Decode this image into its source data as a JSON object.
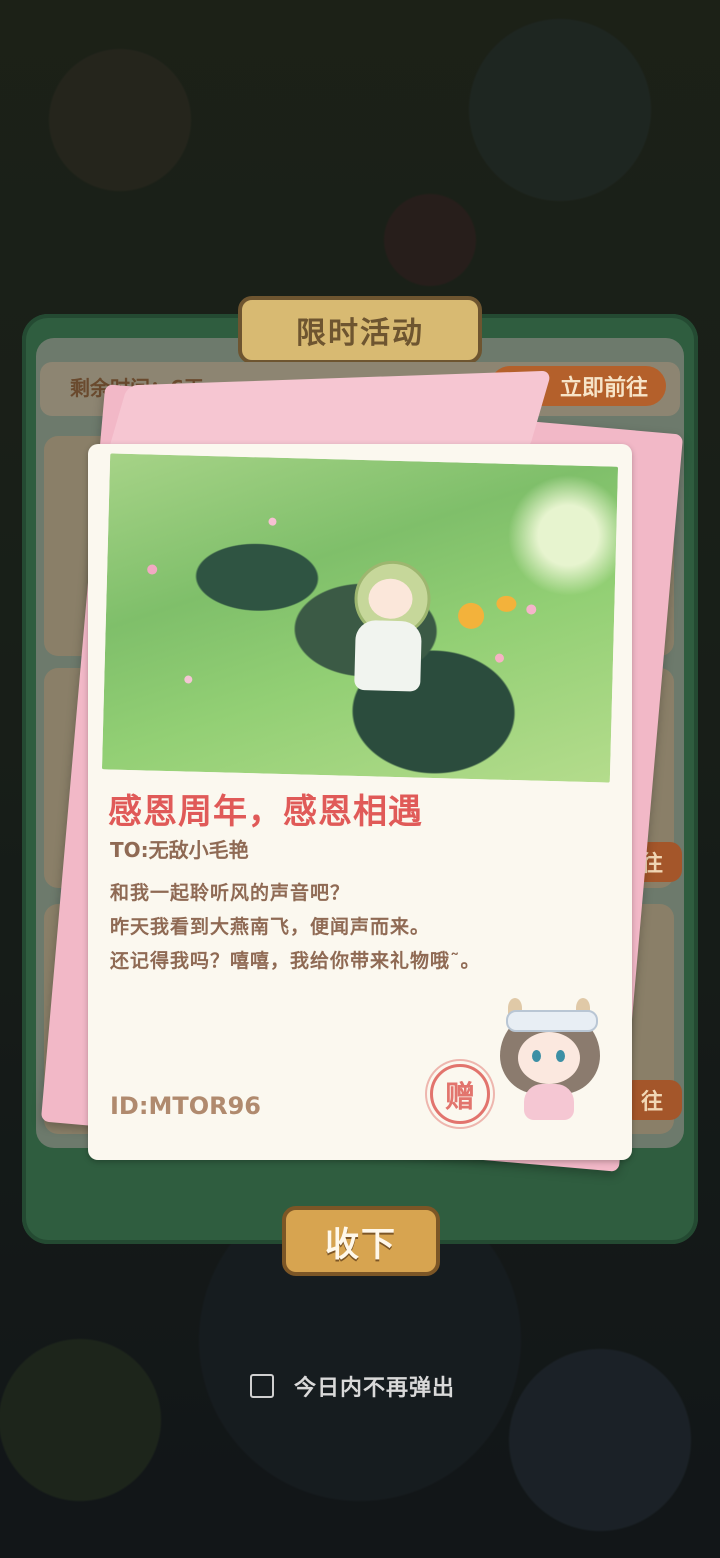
{
  "panel": {
    "title": "限时活动",
    "remaining_time": "剩余时间：6天",
    "goto_label": "立即前往",
    "side_label_1": "剩",
    "side_label_2": "往",
    "side_label_3": "往"
  },
  "letter": {
    "title": "感恩周年，感恩相遇",
    "to": "TO:无敌小毛艳",
    "lines": [
      "和我一起聆听风的声音吧？",
      "昨天我看到大燕南飞，便闻声而来。",
      "还记得我吗？嘻嘻，我给你带来礼物哦˜。"
    ],
    "id": "ID:MTOR96",
    "stamp_char": "赠"
  },
  "collect_button": "收下",
  "dont_show_today": {
    "label": "今日内不再弹出",
    "checked": false
  },
  "colors": {
    "title_red": "#e05a58",
    "text_brown": "#8f6a54",
    "envelope_pink": "#f2b8c7",
    "button_gold": "#d7a450"
  }
}
